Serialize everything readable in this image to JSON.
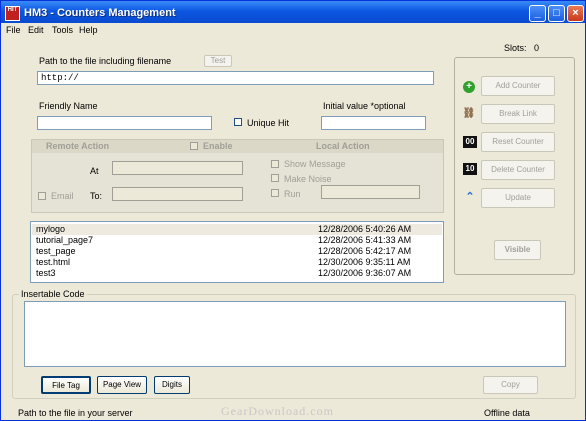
{
  "window": {
    "title": "HM3 - Counters Management",
    "app_icon_text": "HIT"
  },
  "menu": [
    "File",
    "Edit",
    "Tools",
    "Help"
  ],
  "slots": {
    "label": "Slots:",
    "value": "0"
  },
  "form": {
    "path_label": "Path to the file including filename",
    "test_button": "Test",
    "path_value": "http://",
    "friendly_label": "Friendly Name",
    "friendly_value": "",
    "unique_hit_label": "Unique Hit",
    "initial_label": "Initial value  *optional",
    "initial_value": ""
  },
  "action_panel": {
    "remote_label": "Remote  Action",
    "enable_label": "Enable",
    "local_label": "Local  Action",
    "at_label": "At",
    "email_label": "Email",
    "to_label": "To:",
    "show_message_label": "Show Message",
    "make_noise_label": "Make Noise",
    "run_label": "Run"
  },
  "side_buttons": {
    "add": "Add Counter",
    "break": "Break Link",
    "reset": "Reset Counter",
    "delete": "Delete Counter",
    "update": "Update",
    "visible": "Visible"
  },
  "side_icons": {
    "add": "plus-icon",
    "break": "link-icon",
    "reset": "00",
    "delete": "10",
    "update": "up-arrows-icon"
  },
  "counters": [
    {
      "name": "mylogo",
      "date": "12/28/2006 5:40:26 AM"
    },
    {
      "name": "tutorial_page7",
      "date": "12/28/2006 5:41:33 AM"
    },
    {
      "name": "test_page",
      "date": "12/28/2006 5:42:17 AM"
    },
    {
      "name": "test.html",
      "date": "12/30/2006 9:35:11 AM"
    },
    {
      "name": "test3",
      "date": "12/30/2006 9:36:07 AM"
    }
  ],
  "code_group": {
    "title": "Insertable Code",
    "value": ""
  },
  "tabs": [
    "File Tag",
    "Page View",
    "Digits"
  ],
  "copy_button": "Copy",
  "status": {
    "left": "Path to the file in your server",
    "right": "Offline data"
  },
  "watermark": "GearDownload.com",
  "colors": {
    "titlebar": "#0b56e0",
    "face": "#ece9d8",
    "add_icon": "#2fa12f",
    "update_icon": "#2a6fd6"
  }
}
